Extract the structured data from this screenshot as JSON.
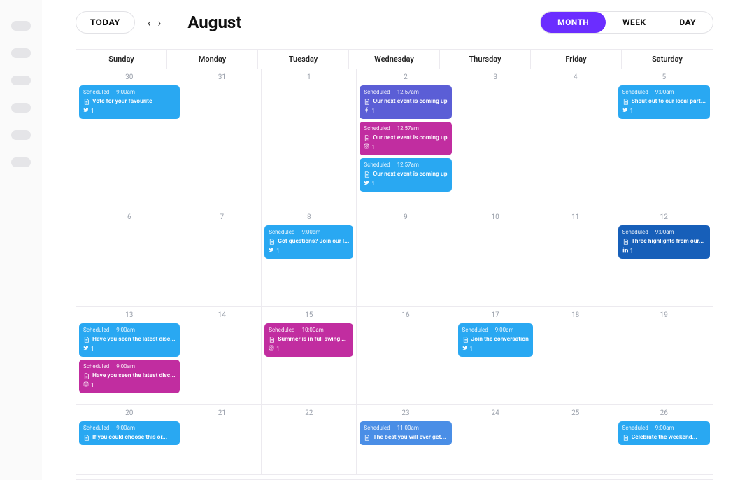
{
  "sidebar": {
    "items_count": 6
  },
  "header": {
    "today": "TODAY",
    "month_title": "August",
    "views": {
      "month": "MONTH",
      "week": "WEEK",
      "day": "DAY"
    },
    "active_view": "month"
  },
  "days_of_week": [
    "Sunday",
    "Monday",
    "Tuesday",
    "Wednesday",
    "Thursday",
    "Friday",
    "Saturday"
  ],
  "labels": {
    "status_scheduled": "Scheduled"
  },
  "cells": [
    {
      "num": "30",
      "events": [
        {
          "color": "ev-blue",
          "status": "Scheduled",
          "time": "9:00am",
          "title": "Vote for your favourite",
          "platform": "twitter",
          "count": "1"
        }
      ]
    },
    {
      "num": "31",
      "events": []
    },
    {
      "num": "1",
      "events": []
    },
    {
      "num": "2",
      "events": [
        {
          "color": "ev-indigo",
          "status": "Scheduled",
          "time": "12:57am",
          "title": "Our next event is coming up",
          "platform": "facebook",
          "count": "1"
        },
        {
          "color": "ev-pink",
          "status": "Scheduled",
          "time": "12:57am",
          "title": "Our next event is coming up",
          "platform": "instagram",
          "count": "1"
        },
        {
          "color": "ev-blue",
          "status": "Scheduled",
          "time": "12:57am",
          "title": "Our next event is coming up",
          "platform": "twitter",
          "count": "1"
        }
      ]
    },
    {
      "num": "3",
      "events": []
    },
    {
      "num": "4",
      "events": []
    },
    {
      "num": "5",
      "events": [
        {
          "color": "ev-blue",
          "status": "Scheduled",
          "time": "9:00am",
          "title": "Shout out to our local part...",
          "platform": "twitter",
          "count": "1"
        }
      ]
    },
    {
      "num": "6",
      "events": []
    },
    {
      "num": "7",
      "events": []
    },
    {
      "num": "8",
      "events": [
        {
          "color": "ev-blue",
          "status": "Scheduled",
          "time": "9:00am",
          "title": "Got questions? Join our l...",
          "platform": "twitter",
          "count": "1"
        }
      ]
    },
    {
      "num": "9",
      "events": []
    },
    {
      "num": "10",
      "events": []
    },
    {
      "num": "11",
      "events": []
    },
    {
      "num": "12",
      "events": [
        {
          "color": "ev-darkblue",
          "status": "Scheduled",
          "time": "9:00am",
          "title": "Three highlights from our...",
          "platform": "linkedin",
          "count": "1"
        }
      ]
    },
    {
      "num": "13",
      "events": [
        {
          "color": "ev-blue",
          "status": "Scheduled",
          "time": "9:00am",
          "title": "Have you seen the latest disc...",
          "platform": "twitter",
          "count": "1"
        },
        {
          "color": "ev-pink",
          "status": "Scheduled",
          "time": "9:00am",
          "title": "Have you seen the latest disc...",
          "platform": "instagram",
          "count": "1"
        }
      ]
    },
    {
      "num": "14",
      "events": []
    },
    {
      "num": "15",
      "events": [
        {
          "color": "ev-pink",
          "status": "Scheduled",
          "time": "10:00am",
          "title": "Summer is in full swing ...",
          "platform": "instagram",
          "count": "1"
        }
      ]
    },
    {
      "num": "16",
      "events": []
    },
    {
      "num": "17",
      "events": [
        {
          "color": "ev-blue",
          "status": "Scheduled",
          "time": "9:00am",
          "title": "Join the conversation",
          "platform": "twitter",
          "count": "1"
        }
      ]
    },
    {
      "num": "18",
      "events": []
    },
    {
      "num": "19",
      "events": []
    },
    {
      "num": "20",
      "events": [
        {
          "color": "ev-blue",
          "status": "Scheduled",
          "time": "9:00am",
          "title": "If you could choose this or...",
          "platform": "",
          "count": ""
        }
      ]
    },
    {
      "num": "21",
      "events": []
    },
    {
      "num": "22",
      "events": []
    },
    {
      "num": "23",
      "events": [
        {
          "color": "ev-blue2",
          "status": "Scheduled",
          "time": "11:00am",
          "title": "The best you will ever get...",
          "platform": "",
          "count": ""
        }
      ]
    },
    {
      "num": "24",
      "events": []
    },
    {
      "num": "25",
      "events": []
    },
    {
      "num": "26",
      "events": [
        {
          "color": "ev-blue",
          "status": "Scheduled",
          "time": "9:00am",
          "title": "Celebrate the weekend...",
          "platform": "",
          "count": ""
        }
      ]
    }
  ]
}
